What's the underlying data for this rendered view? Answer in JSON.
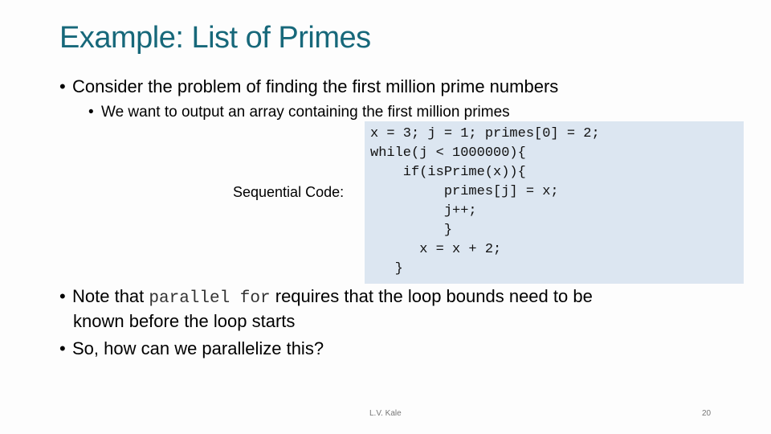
{
  "slide": {
    "title": "Example: List of Primes",
    "bullets": [
      {
        "text": "Consider the problem of finding the first million prime numbers"
      },
      {
        "text": "We want to output an array containing the first million primes"
      }
    ],
    "sequential_label": "Sequential Code:",
    "code": "x = 3; j = 1; primes[0] = 2;\nwhile(j < 1000000){\n    if(isPrime(x)){\n         primes[j] = x;\n         j++;\n         }\n      x = x + 2;\n   }",
    "note": {
      "prefix": "Note that ",
      "code": "parallel for",
      "suffix": " requires that the loop bounds need to be",
      "continuation": "known before the loop starts"
    },
    "question": "So, how can we parallelize this?",
    "footer": {
      "author": "L.V. Kale",
      "page_number": "20"
    }
  }
}
